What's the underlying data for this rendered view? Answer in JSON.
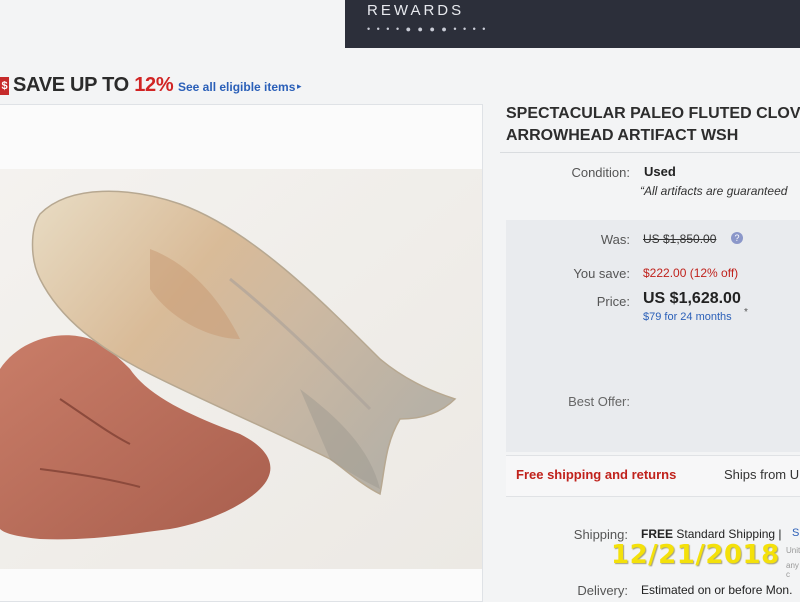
{
  "header": {
    "rewards_label": "REWARDS",
    "rewards_dots": "• • • • ● ● ● ● • • • •"
  },
  "promo": {
    "tag_symbol": "$",
    "save_prefix": "SAVE UP TO ",
    "save_percent": "12%",
    "eligible_link": "See all eligible items",
    "eligible_arrow": "▸"
  },
  "listing": {
    "title_line1": "SPECTACULAR PALEO FLUTED CLOVIS",
    "title_line2": "ARROWHEAD ARTIFACT WSH",
    "condition_label": "Condition:",
    "condition_value": "Used",
    "condition_note": "“All artifacts are guaranteed",
    "was_label": "Was:",
    "was_value": "US $1,850.00",
    "info_symbol": "?",
    "you_save_label": "You save:",
    "you_save_value": "$222.00 (12% off)",
    "price_label": "Price:",
    "price_value": "US $1,628.00",
    "finance_text": "$79 for 24 months",
    "finance_mark": "*",
    "best_offer_label": "Best Offer:",
    "free_shipping": "Free shipping and returns",
    "ships_from": "Ships from U",
    "shipping_label": "Shipping:",
    "shipping_free": "FREE",
    "shipping_method": " Standard Shipping |",
    "shipping_link": "S",
    "faint_line1": "Unite",
    "faint_line2": "any c",
    "delivery_label": "Delivery:",
    "delivery_value": "Estimated on or before Mon."
  },
  "photo": {
    "date_stamp": "12/21/2018"
  },
  "colors": {
    "accent_red": "#c0221c",
    "link_blue": "#2a5fb8",
    "stamp_yellow": "#f4e10a"
  }
}
